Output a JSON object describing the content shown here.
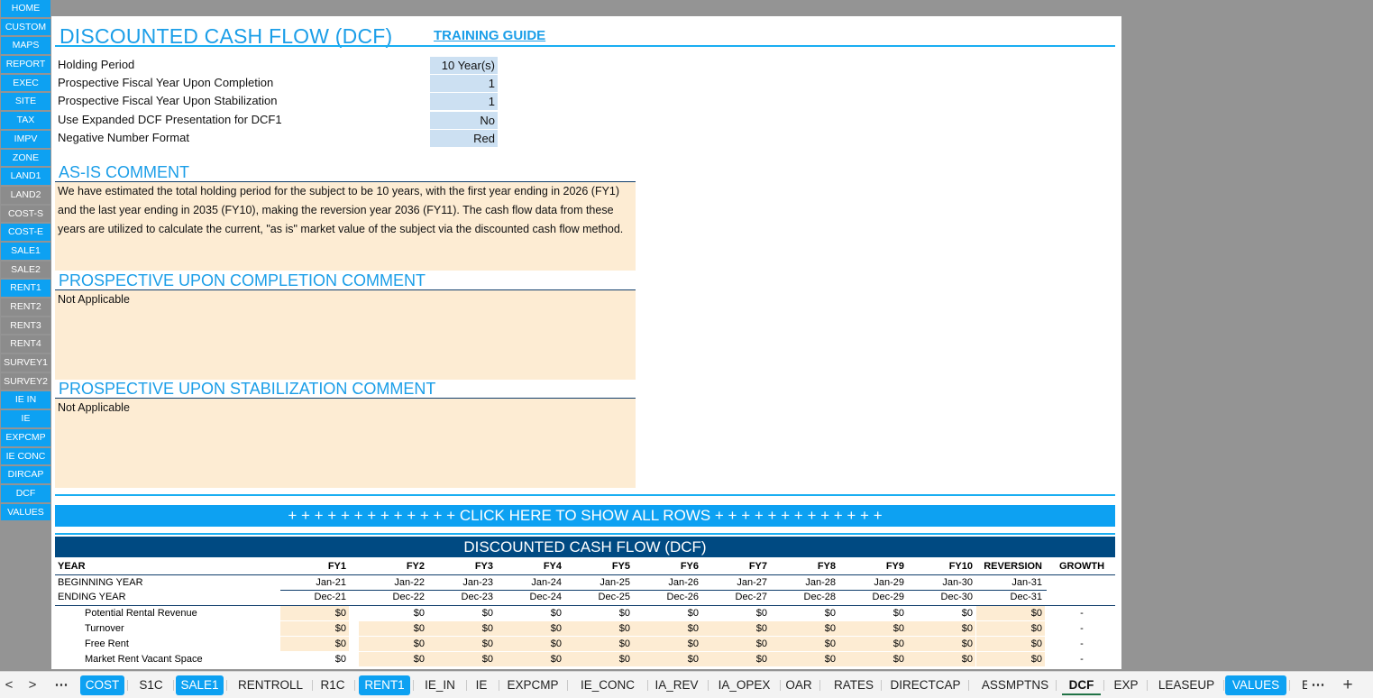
{
  "nav_items": [
    {
      "label": "HOME",
      "color": "blue"
    },
    {
      "label": "CUSTOM",
      "color": "blue"
    },
    {
      "label": "MAPS",
      "color": "blue"
    },
    {
      "label": "REPORT",
      "color": "blue"
    },
    {
      "label": "EXEC",
      "color": "blue"
    },
    {
      "label": "SITE",
      "color": "blue"
    },
    {
      "label": "TAX",
      "color": "blue"
    },
    {
      "label": "IMPV",
      "color": "blue"
    },
    {
      "label": "ZONE",
      "color": "blue"
    },
    {
      "label": "LAND1",
      "color": "blue"
    },
    {
      "label": "LAND2",
      "color": "gray"
    },
    {
      "label": "COST-S",
      "color": "gray"
    },
    {
      "label": "COST-E",
      "color": "blue"
    },
    {
      "label": "SALE1",
      "color": "blue"
    },
    {
      "label": "SALE2",
      "color": "gray"
    },
    {
      "label": "RENT1",
      "color": "blue"
    },
    {
      "label": "RENT2",
      "color": "gray"
    },
    {
      "label": "RENT3",
      "color": "gray"
    },
    {
      "label": "RENT4",
      "color": "gray"
    },
    {
      "label": "SURVEY1",
      "color": "gray"
    },
    {
      "label": "SURVEY2",
      "color": "gray"
    },
    {
      "label": "IE IN",
      "color": "blue"
    },
    {
      "label": "IE",
      "color": "blue"
    },
    {
      "label": "EXPCMP",
      "color": "blue"
    },
    {
      "label": "IE CONC",
      "color": "blue"
    },
    {
      "label": "DIRCAP",
      "color": "blue"
    },
    {
      "label": "DCF",
      "color": "blue"
    },
    {
      "label": "VALUES",
      "color": "blue"
    }
  ],
  "header": {
    "title": "DISCOUNTED CASH FLOW (DCF)",
    "training_guide": "TRAINING GUIDE"
  },
  "params": [
    {
      "label": "Holding Period",
      "value": "10 Year(s)"
    },
    {
      "label": "Prospective Fiscal Year Upon Completion",
      "value": "1"
    },
    {
      "label": "Prospective Fiscal Year Upon Stabilization",
      "value": "1"
    },
    {
      "label": "Use Expanded DCF Presentation for DCF1",
      "value": "No"
    },
    {
      "label": "Negative Number Format",
      "value": "Red"
    }
  ],
  "comments": {
    "as_is": {
      "heading": "AS-IS COMMENT",
      "text": "We have estimated the total holding period for the subject to be 10 years, with the first year ending in 2026 (FY1) and the last year ending in 2035 (FY10), making the reversion year 2036 (FY11). The cash flow data from these years are utilized to calculate the current, \"as is\" market value of the subject via the discounted cash flow method."
    },
    "completion": {
      "heading": "PROSPECTIVE UPON COMPLETION COMMENT",
      "text": "Not Applicable"
    },
    "stabilization": {
      "heading": "PROSPECTIVE UPON STABILIZATION COMMENT",
      "text": "Not Applicable"
    }
  },
  "show_rows_button": "+ + + + + + + + + + + + + CLICK HERE TO SHOW ALL ROWS + + + + + + + + + + + + +",
  "dcf_table": {
    "heading": "DISCOUNTED CASH FLOW (DCF)",
    "year_label": "YEAR",
    "columns": [
      "FY1",
      "FY2",
      "FY3",
      "FY4",
      "FY5",
      "FY6",
      "FY7",
      "FY8",
      "FY9",
      "FY10",
      "REVERSION",
      "GROWTH"
    ],
    "beginning_label": "BEGINNING YEAR",
    "beginning": [
      "Jan-21",
      "Jan-22",
      "Jan-23",
      "Jan-24",
      "Jan-25",
      "Jan-26",
      "Jan-27",
      "Jan-28",
      "Jan-29",
      "Jan-30",
      "Jan-31"
    ],
    "ending_label": "ENDING YEAR",
    "ending": [
      "Dec-21",
      "Dec-22",
      "Dec-23",
      "Dec-24",
      "Dec-25",
      "Dec-26",
      "Dec-27",
      "Dec-28",
      "Dec-29",
      "Dec-30",
      "Dec-31"
    ],
    "rows": [
      {
        "label": "Potential Rental Revenue",
        "values": [
          "$0",
          "$0",
          "$0",
          "$0",
          "$0",
          "$0",
          "$0",
          "$0",
          "$0",
          "$0",
          "$0"
        ],
        "growth": "-"
      },
      {
        "label": "Turnover",
        "values": [
          "$0",
          "$0",
          "$0",
          "$0",
          "$0",
          "$0",
          "$0",
          "$0",
          "$0",
          "$0",
          "$0"
        ],
        "growth": "-"
      },
      {
        "label": "Free Rent",
        "values": [
          "$0",
          "$0",
          "$0",
          "$0",
          "$0",
          "$0",
          "$0",
          "$0",
          "$0",
          "$0",
          "$0"
        ],
        "growth": "-"
      },
      {
        "label": "Market Rent Vacant Space",
        "values": [
          "$0",
          "$0",
          "$0",
          "$0",
          "$0",
          "$0",
          "$0",
          "$0",
          "$0",
          "$0",
          "$0"
        ],
        "growth": "-"
      }
    ]
  },
  "sheet_tabs": [
    {
      "label": "COST",
      "style": "colored"
    },
    {
      "label": "S1C",
      "style": "plain"
    },
    {
      "label": "SALE1",
      "style": "colored"
    },
    {
      "label": "RENTROLL",
      "style": "plain"
    },
    {
      "label": "R1C",
      "style": "plain"
    },
    {
      "label": "RENT1",
      "style": "colored"
    },
    {
      "label": "IE_IN",
      "style": "plain"
    },
    {
      "label": "IE",
      "style": "plain"
    },
    {
      "label": "EXPCMP",
      "style": "plain"
    },
    {
      "label": "IE_CONC",
      "style": "plain"
    },
    {
      "label": "IA_REV",
      "style": "plain"
    },
    {
      "label": "IA_OPEX",
      "style": "plain"
    },
    {
      "label": "OAR",
      "style": "plain"
    },
    {
      "label": "RATES",
      "style": "plain"
    },
    {
      "label": "DIRECTCAP",
      "style": "plain"
    },
    {
      "label": "ASSMPTNS",
      "style": "plain"
    },
    {
      "label": "DCF",
      "style": "active"
    },
    {
      "label": "EXP",
      "style": "plain"
    },
    {
      "label": "LEASEUP",
      "style": "plain"
    },
    {
      "label": "VALUES",
      "style": "colored"
    },
    {
      "label": "E",
      "style": "plain"
    }
  ],
  "tabbar_controls": {
    "prev": "<",
    "next": ">",
    "more_left": "⋯",
    "more_right": "⋯",
    "add": "+"
  }
}
